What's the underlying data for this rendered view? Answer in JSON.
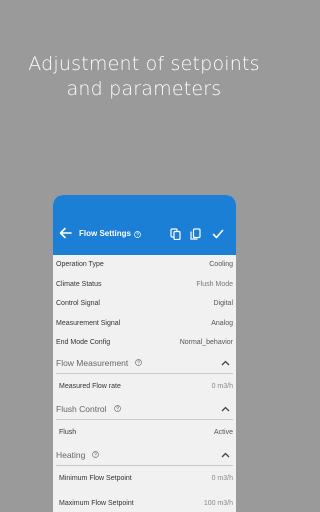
{
  "headline": {
    "line1": "Adjustment of setpoints",
    "line2": "and parameters"
  },
  "appbar": {
    "title": "Flow Settings"
  },
  "params": [
    {
      "label": "Operation Type",
      "value": "Cooling"
    },
    {
      "label": "Climate Status",
      "value": "Flush Mode"
    },
    {
      "label": "Control Signal",
      "value": "Digital"
    },
    {
      "label": "Measurement Signal",
      "value": "Analog"
    },
    {
      "label": "End Mode Config",
      "value": "Normal_behavior"
    }
  ],
  "sections": {
    "flow_measurement": {
      "title": "Flow Measurement",
      "row_label": "Measured Flow rate",
      "row_value": "0 m3/h"
    },
    "flush_control": {
      "title": "Flush Control",
      "row_label": "Flush",
      "row_value": "Active"
    },
    "heating": {
      "title": "Heating",
      "row_label": "Minimum Flow Setpoint",
      "row_value": "0 m3/h",
      "row2_label": "Maximum Flow Setpoint",
      "row2_value": "100 m3/h"
    }
  },
  "colors": {
    "accent": "#1b7fd6",
    "background": "#9a9a9a"
  },
  "icons": [
    "back-arrow-icon",
    "help-icon",
    "copy-icon",
    "paste-icon",
    "check-icon",
    "chevron-up-icon"
  ]
}
